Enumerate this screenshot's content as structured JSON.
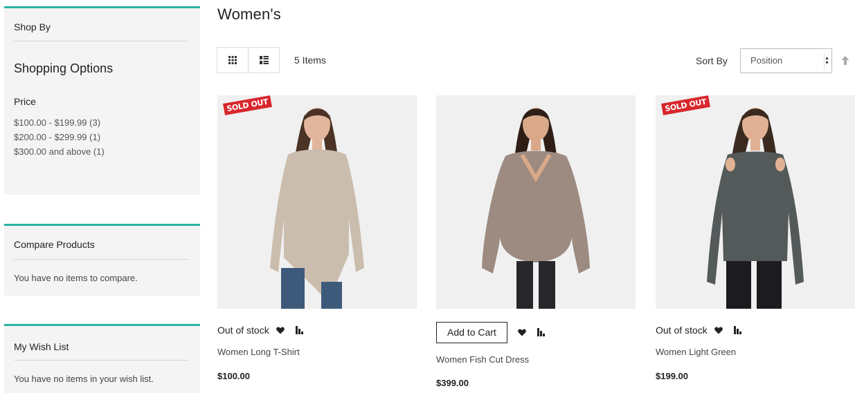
{
  "sidebar": {
    "shop_by": {
      "title": "Shop By",
      "options_title": "Shopping Options",
      "price_title": "Price",
      "price_ranges": [
        "$100.00 - $199.99 (3)",
        "$200.00 - $299.99 (1)",
        "$300.00 and above (1)"
      ]
    },
    "compare": {
      "title": "Compare Products",
      "empty_text": "You have no items to compare."
    },
    "wishlist": {
      "title": "My Wish List",
      "empty_text": "You have no items in your wish list."
    },
    "accent_color": "#2bb3a0"
  },
  "main": {
    "title": "Women's",
    "toolbar": {
      "view_modes": [
        "grid-icon",
        "list-icon"
      ],
      "amount": "5 Items",
      "sort_label": "Sort By",
      "sort_selected": "Position",
      "sort_direction_icon": "arrow-up-icon"
    },
    "products": [
      {
        "badge": "SOLD OUT",
        "status": "Out of stock",
        "name": "Women Long T-Shirt",
        "price": "$100.00",
        "garment_color": "#cbbdae"
      },
      {
        "badge": "",
        "cart_label": "Add to Cart",
        "name": "Women Fish Cut Dress",
        "price": "$399.00",
        "garment_color": "#9d8a80"
      },
      {
        "badge": "SOLD OUT",
        "status": "Out of stock",
        "name": "Women Light Green",
        "price": "$199.00",
        "garment_color": "#545a5a"
      }
    ],
    "badge_color": "#d8262c"
  }
}
